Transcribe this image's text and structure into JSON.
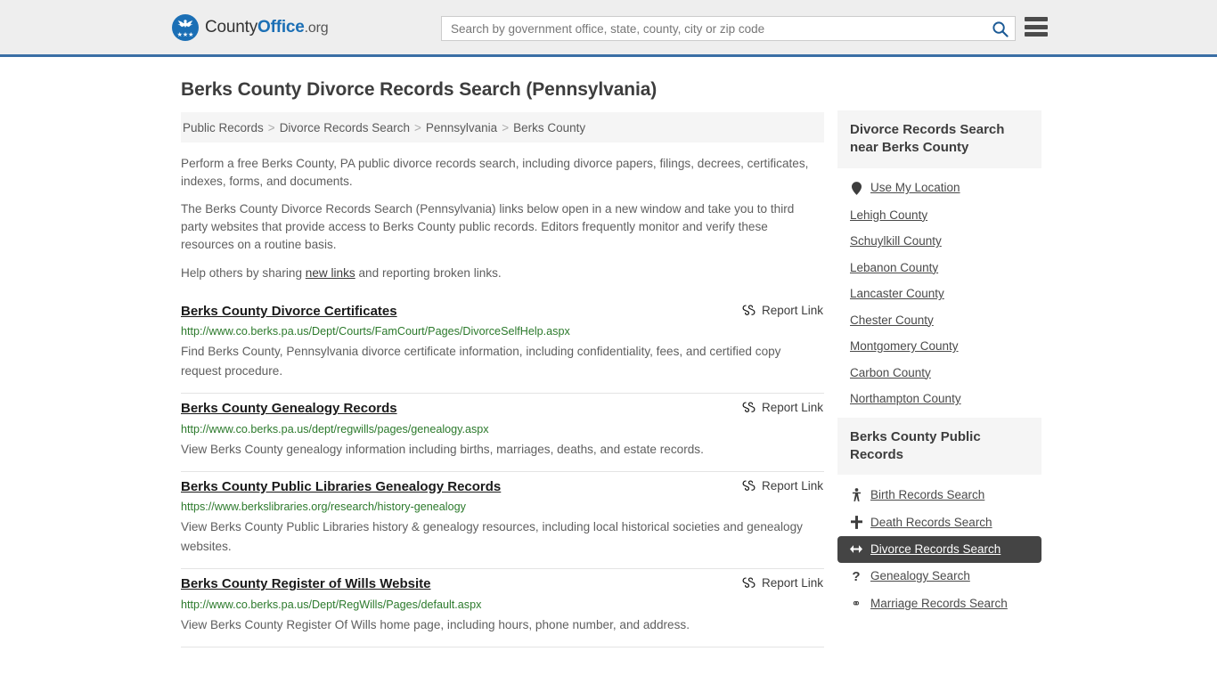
{
  "header": {
    "brand": {
      "part1": "County",
      "part2": "Office",
      "tld": ".org"
    },
    "search": {
      "placeholder": "Search by government office, state, county, city or zip code",
      "value": ""
    },
    "search_icon": "search-icon",
    "menu_icon": "hamburger-menu-icon"
  },
  "page": {
    "title": "Berks County Divorce Records Search (Pennsylvania)"
  },
  "breadcrumb": {
    "items": [
      {
        "label": "Public Records"
      },
      {
        "label": "Divorce Records Search"
      },
      {
        "label": "Pennsylvania"
      },
      {
        "label": "Berks County"
      }
    ],
    "separator": ">"
  },
  "intro": {
    "p1": "Perform a free Berks County, PA public divorce records search, including divorce papers, filings, decrees, certificates, indexes, forms, and documents.",
    "p2": "The Berks County Divorce Records Search (Pennsylvania) links below open in a new window and take you to third party websites that provide access to Berks County public records. Editors frequently monitor and verify these resources on a routine basis.",
    "p3_before": "Help others by sharing ",
    "p3_link": "new links",
    "p3_after": " and reporting broken links."
  },
  "results": {
    "report_label": "Report Link",
    "items": [
      {
        "title": "Berks County Divorce Certificates",
        "url": "http://www.co.berks.pa.us/Dept/Courts/FamCourt/Pages/DivorceSelfHelp.aspx",
        "description": "Find Berks County, Pennsylvania divorce certificate information, including confidentiality, fees, and certified copy request procedure.",
        "report_label": "Report Link"
      },
      {
        "title": "Berks County Genealogy Records",
        "url": "http://www.co.berks.pa.us/dept/regwills/pages/genealogy.aspx",
        "description": "View Berks County genealogy information including births, marriages, deaths, and estate records.",
        "report_label": "Report Link"
      },
      {
        "title": "Berks County Public Libraries Genealogy Records",
        "url": "https://www.berkslibraries.org/research/history-genealogy",
        "description": "View Berks County Public Libraries history & genealogy resources, including local historical societies and genealogy websites.",
        "report_label": "Report Link"
      },
      {
        "title": "Berks County Register of Wills Website",
        "url": "http://www.co.berks.pa.us/Dept/RegWills/Pages/default.aspx",
        "description": "View Berks County Register Of Wills home page, including hours, phone number, and address.",
        "report_label": "Report Link"
      }
    ]
  },
  "sidebar": {
    "nearby": {
      "heading": "Divorce Records Search near Berks County",
      "items": [
        {
          "label": "Use My Location",
          "icon": "map-pin-icon",
          "active": false
        },
        {
          "label": "Lehigh County",
          "icon": "",
          "active": false
        },
        {
          "label": "Schuylkill County",
          "icon": "",
          "active": false
        },
        {
          "label": "Lebanon County",
          "icon": "",
          "active": false
        },
        {
          "label": "Lancaster County",
          "icon": "",
          "active": false
        },
        {
          "label": "Chester County",
          "icon": "",
          "active": false
        },
        {
          "label": "Montgomery County",
          "icon": "",
          "active": false
        },
        {
          "label": "Carbon County",
          "icon": "",
          "active": false
        },
        {
          "label": "Northampton County",
          "icon": "",
          "active": false
        }
      ]
    },
    "public_records": {
      "heading": "Berks County Public Records",
      "items": [
        {
          "label": "Birth Records Search",
          "icon": "baby-icon",
          "active": false
        },
        {
          "label": "Death Records Search",
          "icon": "cross-icon",
          "active": false
        },
        {
          "label": "Divorce Records Search",
          "icon": "left-right-arrow-icon",
          "active": true
        },
        {
          "label": "Genealogy Search",
          "icon": "question-mark-icon",
          "active": false
        },
        {
          "label": "Marriage Records Search",
          "icon": "male-female-icon",
          "active": false
        }
      ]
    }
  },
  "colors": {
    "header_bg": "#eeeeee",
    "header_rule": "#3a6ea5",
    "brand_blue": "#1b6fb5",
    "url_green": "#2c7a2c",
    "active_bg": "#444444",
    "panel_bg": "#f5f5f5"
  }
}
